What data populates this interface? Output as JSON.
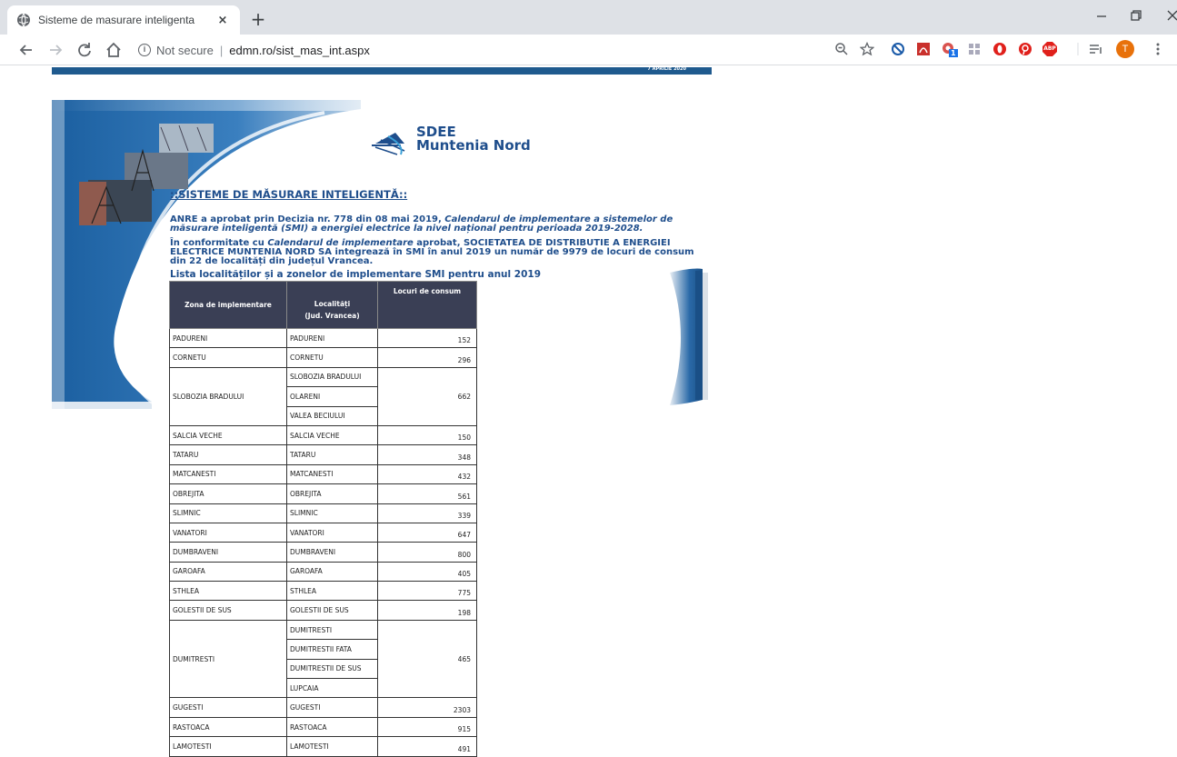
{
  "browser": {
    "tab_title": "Sisteme de masurare inteligenta",
    "tab_close": "×",
    "new_tab": "+",
    "not_secure": "Not secure",
    "url": "edmn.ro/sist_mas_int.aspx",
    "profile_initial": "T",
    "extension_badge": "1",
    "extension_abp": "ABP"
  },
  "page": {
    "date": "7 APRILIE 2020",
    "logo_line1": "SDEE",
    "logo_line2": "Muntenia Nord",
    "heading": "::SISTEME DE MĂSURARE INTELIGENTĂ::",
    "para1_a": "ANRE a aprobat prin Decizia nr. 778 din 08 mai 2019, ",
    "para1_b": "Calendarul de implementare a sistemelor de măsurare inteligentă (SMI) a energiei electrice la nivel național pentru perioada 2019-2028.",
    "para2_a": "În conformitate cu ",
    "para2_b": "Calendarul de implementare",
    "para2_c": " aprobat, SOCIETATEA DE DISTRIBUTIE A ENERGIEI ELECTRICE MUNTENIA NORD SA integrează în SMI în anul 2019 un număr de 9979 de locuri de consum din 22 de localități din județul Vrancea.",
    "list_title": "Lista localităților și a zonelor de implementare SMI pentru anul 2019"
  },
  "table": {
    "headers": {
      "zona": "Zona de implementare",
      "localitati_1": "Localități",
      "localitati_2": "(Jud. Vrancea)",
      "locuri": "Locuri de consum"
    },
    "rows": [
      {
        "zona": "PADURENI",
        "localitati": [
          "PADURENI"
        ],
        "locuri": "152"
      },
      {
        "zona": "CORNETU",
        "localitati": [
          "CORNETU"
        ],
        "locuri": "296"
      },
      {
        "zona": "SLOBOZIA BRADULUI",
        "localitati": [
          "SLOBOZIA BRADULUI",
          "OLARENI",
          "VALEA BECIULUI"
        ],
        "locuri": "662"
      },
      {
        "zona": "SALCIA VECHE",
        "localitati": [
          "SALCIA VECHE"
        ],
        "locuri": "150"
      },
      {
        "zona": "TATARU",
        "localitati": [
          "TATARU"
        ],
        "locuri": "348"
      },
      {
        "zona": "MATCANESTI",
        "localitati": [
          "MATCANESTI"
        ],
        "locuri": "432"
      },
      {
        "zona": "OBREJITA",
        "localitati": [
          "OBREJITA"
        ],
        "locuri": "561"
      },
      {
        "zona": "SLIMNIC",
        "localitati": [
          "SLIMNIC"
        ],
        "locuri": "339"
      },
      {
        "zona": "VANATORI",
        "localitati": [
          "VANATORI"
        ],
        "locuri": "647"
      },
      {
        "zona": "DUMBRAVENI",
        "localitati": [
          "DUMBRAVENI"
        ],
        "locuri": "800"
      },
      {
        "zona": "GAROAFA",
        "localitati": [
          "GAROAFA"
        ],
        "locuri": "405"
      },
      {
        "zona": "STHLEA",
        "localitati": [
          "STHLEA"
        ],
        "locuri": "775"
      },
      {
        "zona": "GOLESTII DE SUS",
        "localitati": [
          "GOLESTII DE SUS"
        ],
        "locuri": "198"
      },
      {
        "zona": "DUMITRESTI",
        "localitati": [
          "DUMITRESTI",
          "DUMITRESTII FATA",
          "DUMITRESTII DE SUS",
          "LUPCAIA"
        ],
        "locuri": "465"
      },
      {
        "zona": "GUGESTI",
        "localitati": [
          "GUGESTI"
        ],
        "locuri": "2303"
      },
      {
        "zona": "RASTOACA",
        "localitati": [
          "RASTOACA"
        ],
        "locuri": "915"
      },
      {
        "zona": "LAMOTESTI",
        "localitati": [
          "LAMOTESTI"
        ],
        "locuri": "491"
      }
    ]
  }
}
